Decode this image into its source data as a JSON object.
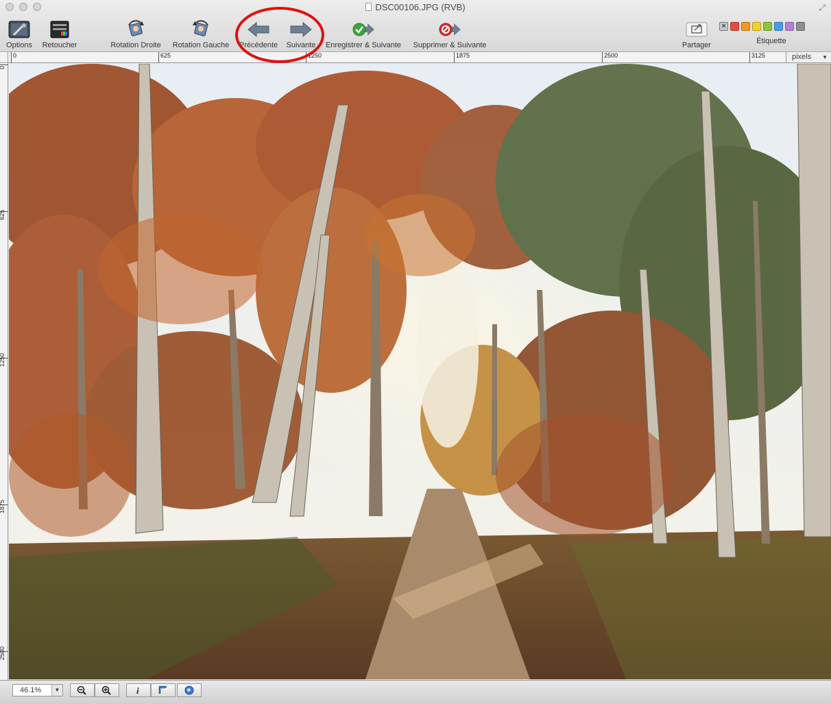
{
  "window": {
    "title": "DSC00106.JPG (RVB)"
  },
  "toolbar": {
    "options_label": "Options",
    "retoucher_label": "Retoucher",
    "rotation_droite_label": "Rotation Droite",
    "rotation_gauche_label": "Rotation Gauche",
    "precedente_label": "Précédente",
    "suivante_label": "Suivante",
    "enregistrer_label": "Enregistrer & Suivante",
    "supprimer_label": "Supprimer & Suivante",
    "partager_label": "Partager",
    "etiquette_label": "Étiquette",
    "label_colors": [
      "#e84a3f",
      "#f39a1e",
      "#f1d12a",
      "#8cc63f",
      "#4a9be8",
      "#b77fd6",
      "#8e8e8e"
    ],
    "label_clear": "×"
  },
  "ruler": {
    "top_ticks": [
      "0",
      "625",
      "1250",
      "1875",
      "2500",
      "3125"
    ],
    "left_ticks": [
      "0",
      "625",
      "1250",
      "1875",
      "2500"
    ],
    "units": "pixels"
  },
  "bottombar": {
    "zoom_value": "46.1%"
  },
  "colors": {
    "annotation_circle": "#e01010"
  }
}
